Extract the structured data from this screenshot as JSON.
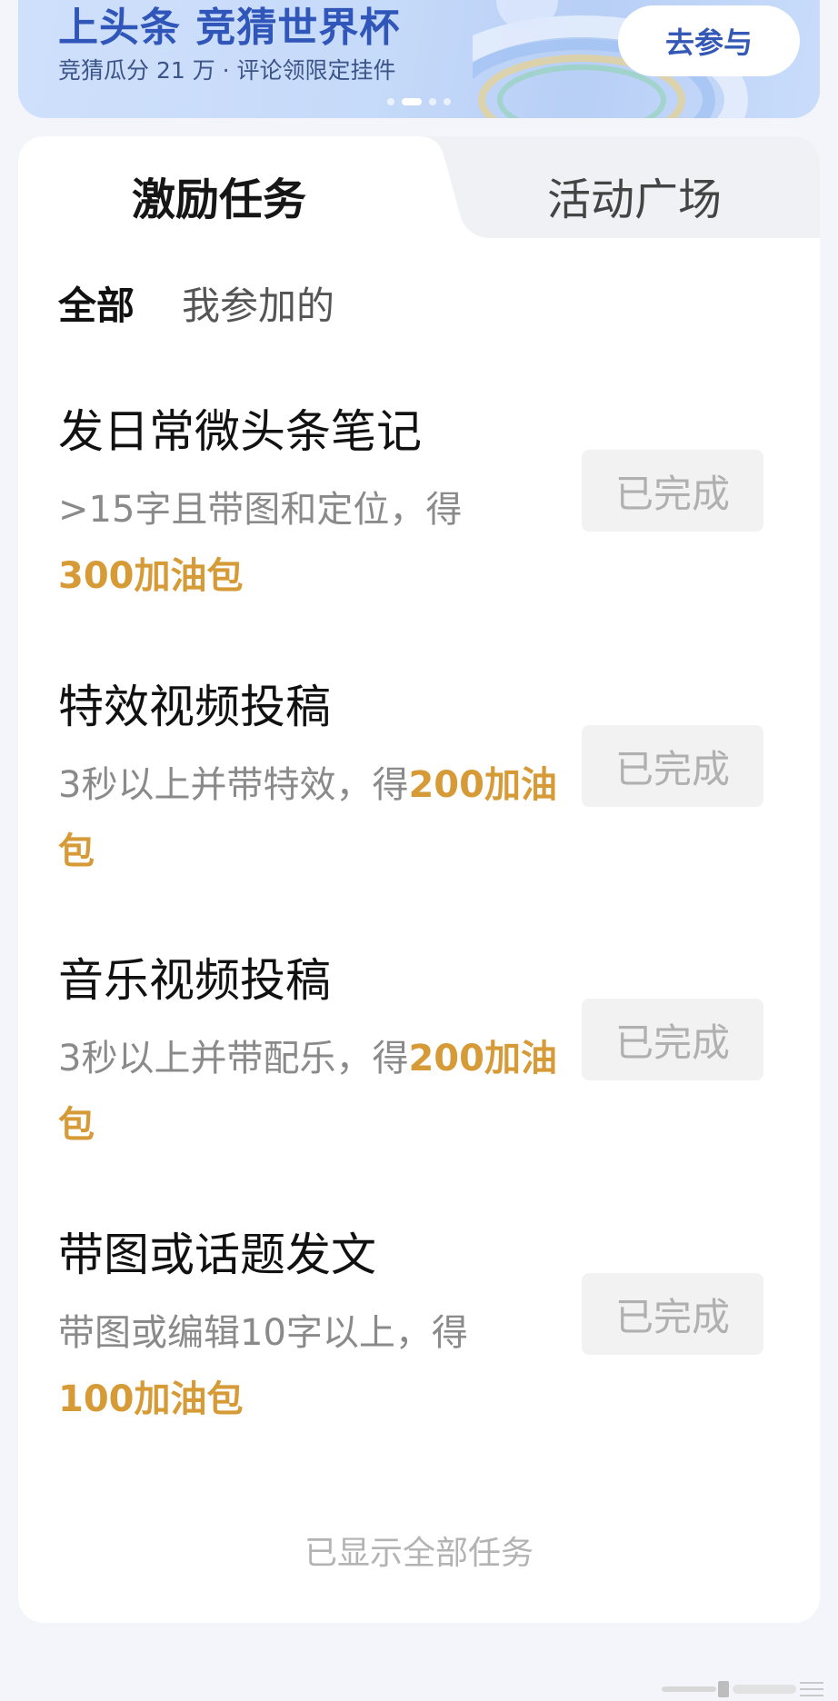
{
  "banner": {
    "title": "上头条 竞猜世界杯",
    "subtitle": "竞猜瓜分 21 万 · 评论领限定挂件",
    "cta_label": "去参与",
    "carousel_pages": 4,
    "carousel_active_index": 1
  },
  "tabs": [
    {
      "label": "激励任务",
      "active": true
    },
    {
      "label": "活动广场",
      "active": false
    }
  ],
  "filters": [
    {
      "label": "全部",
      "active": true
    },
    {
      "label": "我参加的",
      "active": false
    }
  ],
  "tasks": [
    {
      "title": "发日常微头条笔记",
      "desc_prefix": ">15字且带图和定位，得",
      "reward": "300加油包",
      "status": "已完成"
    },
    {
      "title": "特效视频投稿",
      "desc_prefix": "3秒以上并带特效，得",
      "reward": "200加油包",
      "status": "已完成"
    },
    {
      "title": "音乐视频投稿",
      "desc_prefix": "3秒以上并带配乐，得",
      "reward": "200加油包",
      "status": "已完成"
    },
    {
      "title": "带图或话题发文",
      "desc_prefix": "带图或编辑10字以上，得",
      "reward": "100加油包",
      "status": "已完成"
    }
  ],
  "footer_note": "已显示全部任务",
  "colors": {
    "reward": "#d69a36",
    "banner_title": "#2f56b8",
    "page_bg": "#f3f5fb"
  }
}
